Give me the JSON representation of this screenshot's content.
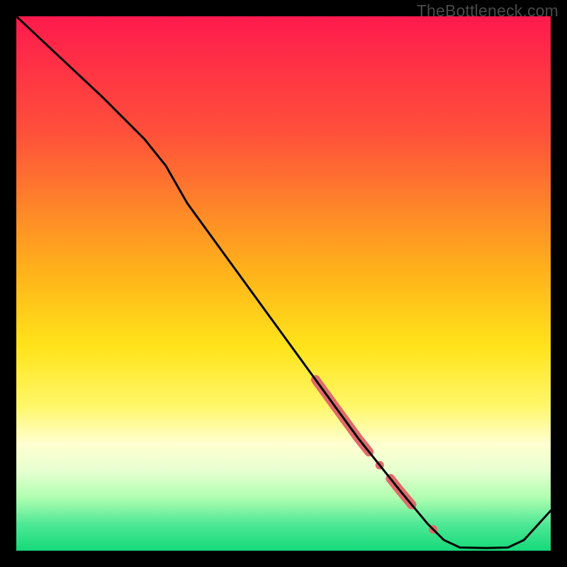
{
  "watermark": "TheBottleneck.com",
  "chart_data": {
    "type": "line",
    "title": "",
    "xlabel": "",
    "ylabel": "",
    "xlim": [
      0,
      100
    ],
    "ylim": [
      0,
      100
    ],
    "gradient_stops": [
      {
        "offset": 0,
        "color": "#ff1a4d"
      },
      {
        "offset": 22,
        "color": "#ff513a"
      },
      {
        "offset": 48,
        "color": "#ffb31a"
      },
      {
        "offset": 62,
        "color": "#ffe41a"
      },
      {
        "offset": 73,
        "color": "#fff76a"
      },
      {
        "offset": 80,
        "color": "#ffffd0"
      },
      {
        "offset": 85,
        "color": "#e8ffd0"
      },
      {
        "offset": 90,
        "color": "#b0ffb0"
      },
      {
        "offset": 95,
        "color": "#4fe896"
      },
      {
        "offset": 100,
        "color": "#15d97a"
      }
    ],
    "curve": [
      {
        "x": 0,
        "y": 100.0
      },
      {
        "x": 8,
        "y": 92.5
      },
      {
        "x": 16,
        "y": 85.0
      },
      {
        "x": 24,
        "y": 77.0
      },
      {
        "x": 28,
        "y": 72.0
      },
      {
        "x": 32,
        "y": 65.0
      },
      {
        "x": 40,
        "y": 54.0
      },
      {
        "x": 48,
        "y": 43.0
      },
      {
        "x": 56,
        "y": 32.0
      },
      {
        "x": 64,
        "y": 21.0
      },
      {
        "x": 72,
        "y": 11.0
      },
      {
        "x": 77,
        "y": 5.0
      },
      {
        "x": 80,
        "y": 2.0
      },
      {
        "x": 83,
        "y": 0.6
      },
      {
        "x": 88,
        "y": 0.5
      },
      {
        "x": 92,
        "y": 0.6
      },
      {
        "x": 95,
        "y": 2.0
      },
      {
        "x": 100,
        "y": 7.5
      }
    ],
    "highlights": [
      {
        "type": "segment",
        "x_start": 56,
        "x_end": 66,
        "thickness": "thick"
      },
      {
        "type": "dot",
        "x": 68
      },
      {
        "type": "segment",
        "x_start": 70,
        "x_end": 74,
        "thickness": "thick"
      },
      {
        "type": "dot",
        "x": 78
      }
    ],
    "highlight_color": "#e16a6a"
  }
}
